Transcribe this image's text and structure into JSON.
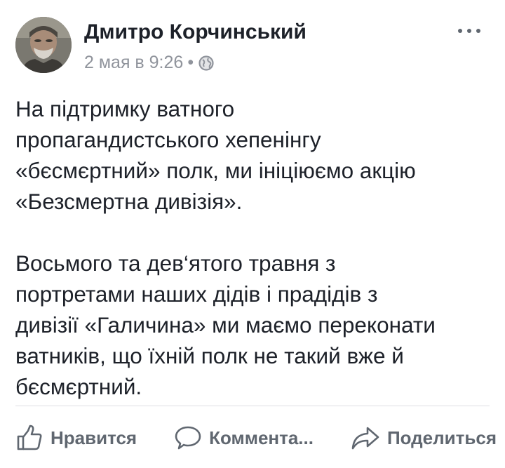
{
  "post": {
    "author": "Дмитро Корчинський",
    "timestamp": "2 мая в 9:26",
    "separator": "•",
    "audience_icon": "globe-icon",
    "more_icon": "more-dots-icon",
    "paragraphs": [
      {
        "lines": [
          "На підтримку ватного",
          "пропагандистського хепенінгу",
          "«бєсмєртний» полк, ми ініціюємо акцію",
          "«Безсмертна дивізія»."
        ]
      },
      {
        "lines": [
          "Восьмого та дев‘ятого травня з",
          "портретами наших дідів і прадідів з",
          "дивізії «Галичина» ми маємо переконати",
          "ватників, що їхній полк не такий вже й",
          "бєсмєртний."
        ]
      }
    ]
  },
  "actions": {
    "like_label": "Нравится",
    "comment_label": "Коммента...",
    "share_label": "Поделиться"
  },
  "colors": {
    "text": "#1d2129",
    "secondary": "#90949c",
    "action": "#606770",
    "divider": "#dddfe2"
  }
}
